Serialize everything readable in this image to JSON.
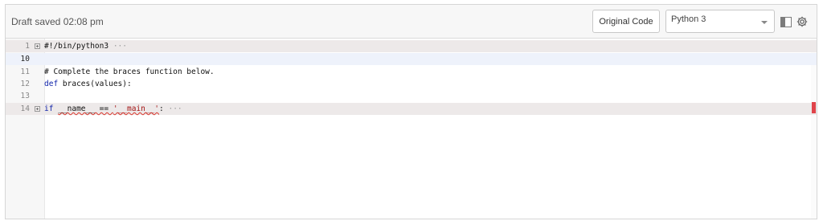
{
  "toolbar": {
    "draft_status": "Draft saved 02:08 pm",
    "original_code_label": "Original Code",
    "language_selected": "Python 3",
    "icons": [
      "layout-toggle-icon",
      "gear-icon"
    ]
  },
  "editor": {
    "lines": [
      {
        "number": "1",
        "folded": true,
        "code": "#!/bin/python3",
        "ellipsis": "···"
      },
      {
        "number": "10",
        "folded": false,
        "code": ""
      },
      {
        "number": "11",
        "folded": false,
        "code": "# Complete the braces function below."
      },
      {
        "number": "12",
        "folded": false,
        "code": "def braces(values):"
      },
      {
        "number": "13",
        "folded": false,
        "code": ""
      },
      {
        "number": "14",
        "folded": true,
        "code": "if __name__ == '__main__':",
        "ellipsis": "···"
      }
    ]
  },
  "colors": {
    "comment": "#1b7f1b",
    "keyword": "#0b1fa8",
    "string": "#a31515",
    "error_marker": "#e0434a"
  }
}
